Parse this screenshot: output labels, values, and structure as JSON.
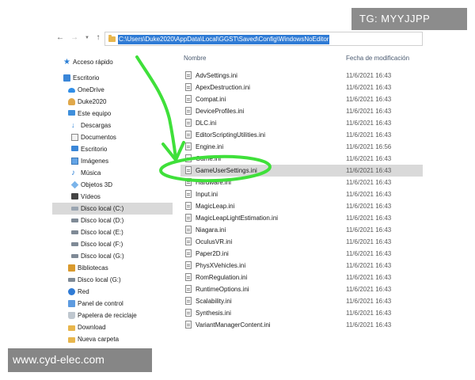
{
  "address_bar": {
    "path": "C:\\Users\\Duke2020\\AppData\\Local\\GGST\\Saved\\Config\\WindowsNoEditor"
  },
  "nav_pane": {
    "items": [
      {
        "label": "Acceso rápido",
        "icon": "star-icon"
      },
      {
        "label": "Escritorio",
        "icon": "desktop-folder-icon"
      },
      {
        "label": "OneDrive",
        "icon": "cloud-icon"
      },
      {
        "label": "Duke2020",
        "icon": "user-folder-icon"
      },
      {
        "label": "Este equipo",
        "icon": "computer-icon"
      },
      {
        "label": "Descargas",
        "icon": "download-icon"
      },
      {
        "label": "Documentos",
        "icon": "documents-icon"
      },
      {
        "label": "Escritorio",
        "icon": "desktop-icon"
      },
      {
        "label": "Imágenes",
        "icon": "pictures-icon"
      },
      {
        "label": "Música",
        "icon": "music-icon"
      },
      {
        "label": "Objetos 3D",
        "icon": "3d-objects-icon"
      },
      {
        "label": "Vídeos",
        "icon": "videos-icon"
      },
      {
        "label": "Disco local (C:)",
        "icon": "drive-icon",
        "selected": true
      },
      {
        "label": "Disco local (D:)",
        "icon": "drive-icon"
      },
      {
        "label": "Disco local (E:)",
        "icon": "drive-icon"
      },
      {
        "label": "Disco local (F:)",
        "icon": "drive-icon"
      },
      {
        "label": "Disco local (G:)",
        "icon": "drive-icon"
      },
      {
        "label": "Bibliotecas",
        "icon": "libraries-icon"
      },
      {
        "label": "Disco local (G:)",
        "icon": "drive-icon"
      },
      {
        "label": "Red",
        "icon": "network-icon"
      },
      {
        "label": "Panel de control",
        "icon": "control-panel-icon"
      },
      {
        "label": "Papelera de reciclaje",
        "icon": "recycle-bin-icon"
      },
      {
        "label": "Download",
        "icon": "folder-icon"
      },
      {
        "label": "Nueva carpeta",
        "icon": "folder-icon"
      }
    ]
  },
  "file_list": {
    "columns": {
      "name": "Nombre",
      "date": "Fecha de modificación"
    },
    "files": [
      {
        "name": "AdvSettings.ini",
        "date": "11/6/2021 16:43"
      },
      {
        "name": "ApexDestruction.ini",
        "date": "11/6/2021 16:43"
      },
      {
        "name": "Compat.ini",
        "date": "11/6/2021 16:43"
      },
      {
        "name": "DeviceProfiles.ini",
        "date": "11/6/2021 16:43"
      },
      {
        "name": "DLC.ini",
        "date": "11/6/2021 16:43"
      },
      {
        "name": "EditorScriptingUtilities.ini",
        "date": "11/6/2021 16:43"
      },
      {
        "name": "Engine.ini",
        "date": "11/6/2021 16:56"
      },
      {
        "name": "Game.ini",
        "date": "11/6/2021 16:43"
      },
      {
        "name": "GameUserSettings.ini",
        "date": "11/6/2021 16:43",
        "selected": true
      },
      {
        "name": "Hardware.ini",
        "date": "11/6/2021 16:43"
      },
      {
        "name": "Input.ini",
        "date": "11/6/2021 16:43"
      },
      {
        "name": "MagicLeap.ini",
        "date": "11/6/2021 16:43"
      },
      {
        "name": "MagicLeapLightEstimation.ini",
        "date": "11/6/2021 16:43"
      },
      {
        "name": "Niagara.ini",
        "date": "11/6/2021 16:43"
      },
      {
        "name": "OculusVR.ini",
        "date": "11/6/2021 16:43"
      },
      {
        "name": "Paper2D.ini",
        "date": "11/6/2021 16:43"
      },
      {
        "name": "PhysXVehicles.ini",
        "date": "11/6/2021 16:43"
      },
      {
        "name": "RomRegulation.ini",
        "date": "11/6/2021 16:43"
      },
      {
        "name": "RuntimeOptions.ini",
        "date": "11/6/2021 16:43"
      },
      {
        "name": "Scalability.ini",
        "date": "11/6/2021 16:43"
      },
      {
        "name": "Synthesis.ini",
        "date": "11/6/2021 16:43"
      },
      {
        "name": "VariantManagerContent.ini",
        "date": "11/6/2021 16:43"
      }
    ]
  },
  "watermarks": {
    "top": "TG: MYYJJPP",
    "bottom": "www.cyd-elec.com"
  },
  "colors": {
    "selection": "#d9d9d9",
    "address_highlight": "#2f7bd5",
    "annotation": "#3fe03a"
  }
}
